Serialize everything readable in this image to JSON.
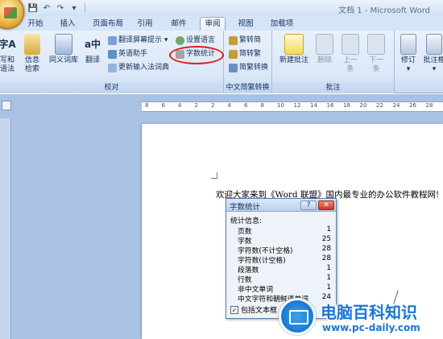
{
  "window": {
    "title": "文档 1 - Microsoft Word"
  },
  "qat": {
    "save": "💾",
    "undo": "↶",
    "redo": "↷",
    "more": "▾"
  },
  "tabs": [
    "开始",
    "插入",
    "页面布局",
    "引用",
    "邮件",
    "审阅",
    "视图",
    "加载项"
  ],
  "active_tab": "审阅",
  "ribbon": {
    "proofing": {
      "label": "校对",
      "spell_a": "写和",
      "spell_b": "语法",
      "spell_icon": "字A",
      "research_a": "信息",
      "research_b": "检索",
      "thesaurus": "同义词库",
      "translate": "翻译",
      "translate_icon": "a中",
      "translate_tip": "翻译屏幕提示 ▾",
      "english_helper": "英语助手",
      "update_ime": "更新输入法词典",
      "set_language": "设置语言",
      "word_count": "字数统计"
    },
    "chinese_conversion": {
      "label": "中文简繁转换",
      "trad_to_simp": "繁转简",
      "simp_to_trad": "简转繁",
      "convert": "简繁转换"
    },
    "comments": {
      "label": "批注",
      "new": "新建批注",
      "delete": "删除",
      "previous_a": "上一",
      "previous_b": "条",
      "next_a": "下一",
      "next_b": "条"
    },
    "tracking": {
      "revise": "修订",
      "revise_arrow": "▾",
      "balloon": "批注框",
      "balloon_arrow": "▾"
    }
  },
  "ruler": {
    "ticks": [
      "8",
      "6",
      "4",
      "2",
      "2",
      "4",
      "6",
      "8",
      "10",
      "12",
      "14",
      "16",
      "18",
      "20",
      "22",
      "24",
      "26",
      "28"
    ]
  },
  "document": {
    "text": "欢迎大家来到《Word 联盟》国内最专业的办公软件教程网!"
  },
  "dialog": {
    "title": "字数统计",
    "help": "?",
    "close": "✕",
    "heading": "统计信息:",
    "stats": [
      {
        "label": "页数",
        "value": "1"
      },
      {
        "label": "字数",
        "value": "25"
      },
      {
        "label": "字符数(不计空格)",
        "value": "28"
      },
      {
        "label": "字符数(计空格)",
        "value": "28"
      },
      {
        "label": "段落数",
        "value": "1"
      },
      {
        "label": "行数",
        "value": "1"
      },
      {
        "label": "非中文单词",
        "value": "1"
      },
      {
        "label": "中文字符和朝鲜语单词",
        "value": "24"
      }
    ],
    "checkbox_label": "包括文本框",
    "checkbox_mark": "✓"
  },
  "watermark": {
    "title": "电脑百科知识",
    "url": "www.pc-daily.com"
  },
  "colors": {
    "highlight": "#e01a1a",
    "ribbon": "#dce8f7",
    "accent": "#1976d2"
  }
}
